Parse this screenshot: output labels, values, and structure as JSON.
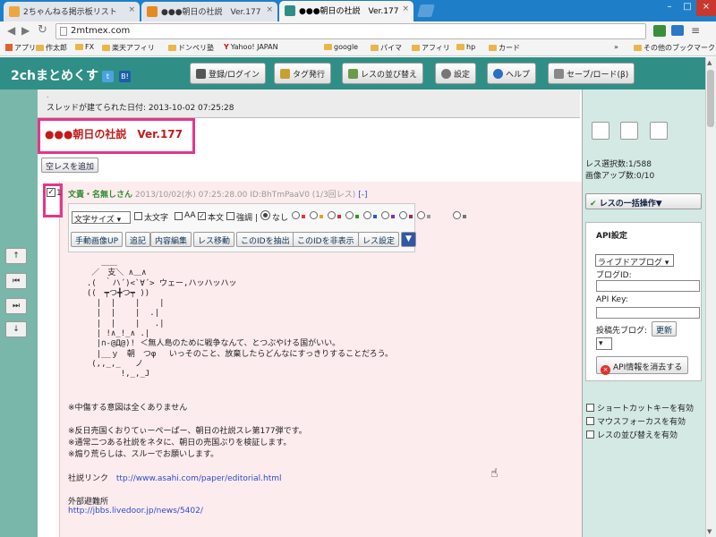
{
  "browser": {
    "tabs": [
      {
        "label": "2ちゃんねる掲示板リスト",
        "active": false,
        "color": "#f0a640"
      },
      {
        "label": "●●●朝日の社説　Ver.177",
        "active": false,
        "color": "#e48a20"
      },
      {
        "label": "●●●朝日の社説　Ver.177",
        "active": true,
        "color": "#2f8f86"
      }
    ],
    "tab_close": "×",
    "url": "2mtmex.com",
    "bookmarks": [
      "アプリ",
      "作太郎",
      "FX",
      "楽天アフィリ",
      "ドンペリ塾",
      "Yahoo! JAPAN",
      "google",
      "パイマ",
      "アフィリ",
      "hp",
      "カード"
    ],
    "bookmarks_more": "»",
    "other_bookmarks": "その他のブックマーク"
  },
  "app": {
    "logo": "2chまとめくす",
    "toolbar": [
      {
        "label": "登録/ログイン",
        "icon": "user-icon"
      },
      {
        "label": "タグ発行",
        "icon": "tag-icon"
      },
      {
        "label": "レスの並び替え",
        "icon": "sort-icon"
      },
      {
        "label": "設定",
        "icon": "gear-icon"
      },
      {
        "label": "ヘルプ",
        "icon": "help-icon"
      },
      {
        "label": "セーブ/ロード(β)",
        "icon": "save-icon"
      }
    ]
  },
  "thread": {
    "created_line": "スレッドが建てられた日付: 2013-10-02 07:25:28",
    "title": "●●●朝日の社説　Ver.177",
    "empty_res_button": "空レスを追加"
  },
  "post": {
    "number": "1",
    "name": "文責・名無しさん",
    "meta": "2013/10/02(水) 07:25:28.00 ID:BhTmPaaV0 (1/3回レス)",
    "link_marker": "[-]",
    "font_size_select": "文字サイズ",
    "options": [
      "太文字",
      "AA",
      "本文",
      "強調 |",
      "なし"
    ],
    "buttons": [
      "手動画像UP",
      "追記",
      "内容編集",
      "レス移動",
      "このIDを抽出",
      "このIDを非表示",
      "レス設定"
    ],
    "more_button": "▼",
    "aa_art": "     ＿＿\n   ／　支＼ ∧＿∧\n  .(　｀ハ´)<`∀´> ウェー,ハッハッハッ\n  ((　┯つ╋つ┯ ))\n    |  |    |    |\n    |  |    |  .|\n    |  |    |   .|\n    | !∧_!_∧ .|\n    |∩-@Д@)! ＜無人島のために戦争なんて、とつぶやける国がいい。\n    |__ｙ　朝　つφ　 いっそのこと、放棄したらどんなにすっきりすることだろう。\n   (,,_,_   ノ\n         !,_,_J",
    "body": [
      "※中傷する意図は全くありません",
      "",
      "※反日売国くおりてぃーぺーぱー、朝日の社説スレ第177弾です。",
      "※通常二つある社説をネタに、朝日の売国ぶりを検証します。",
      "※煽り荒らしは、スルーでお願いします。"
    ],
    "editorial_label": "社説リンク",
    "editorial_url": "ttp://www.asahi.com/paper/editorial.html",
    "refuge_label": "外部避難所",
    "refuge_url": "http://jbbs.livedoor.jp/news/5402/"
  },
  "right_panel": {
    "selected_count": "レス選択数:1/588",
    "image_count": "画像アップ数:0/10",
    "bulk_action": "レスの一括操作▼",
    "api": {
      "title": "API設定",
      "service_select": "ライブドアブログ",
      "blog_id_label": "ブログID:",
      "api_key_label": "API Key:",
      "post_blog_label": "投稿先ブログ:",
      "update_button": "更新",
      "delete_button": "API情報を消去する"
    },
    "checkboxes": [
      "ショートカットキーを有効",
      "マウスフォーカスを有効",
      "レスの並び替えを有効"
    ]
  },
  "colors": {
    "tabbar": "#1e7fc8",
    "header": "#2f8f86",
    "highlight": "#e5368b",
    "title_red": "#c31a1a",
    "post_bg": "#fdecee",
    "name_green": "#2c8a2c"
  }
}
